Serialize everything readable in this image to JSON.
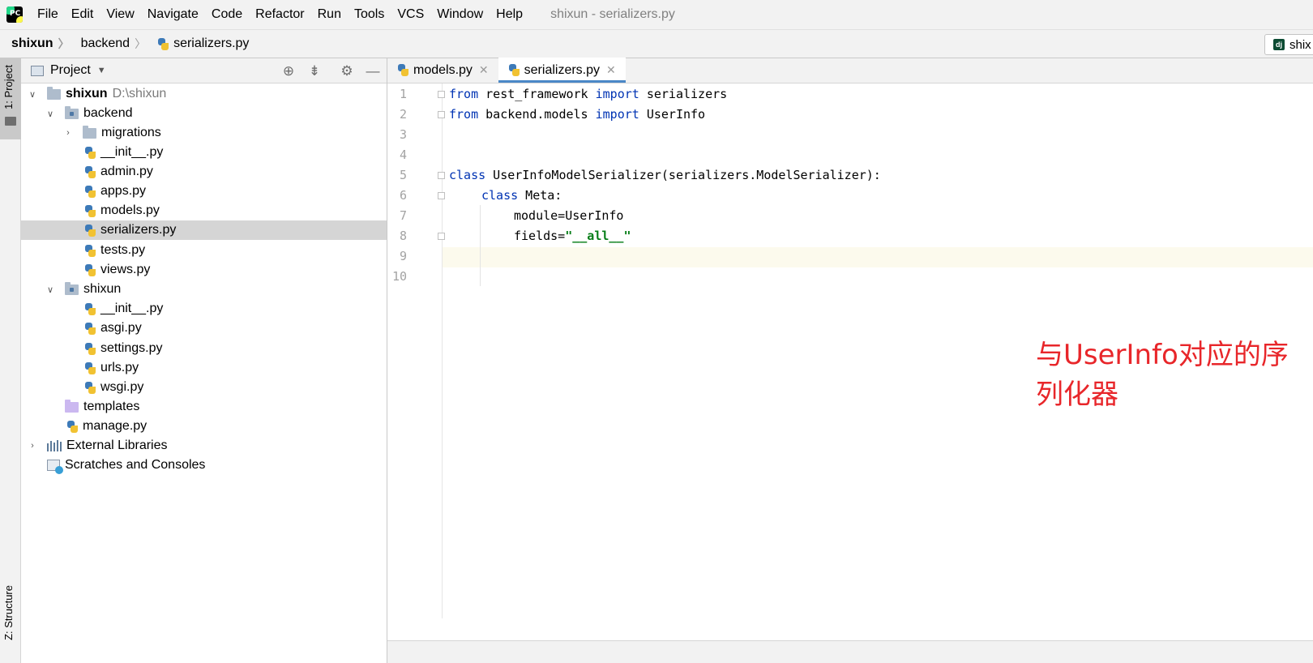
{
  "app": {
    "logo_text": "PC",
    "menu": [
      "File",
      "Edit",
      "View",
      "Navigate",
      "Code",
      "Refactor",
      "Run",
      "Tools",
      "VCS",
      "Window",
      "Help"
    ],
    "window_title": "shixun - serializers.py"
  },
  "breadcrumb": {
    "items": [
      "shixun",
      "backend",
      "serializers.py"
    ],
    "run_config_label": "shix",
    "run_config_icon": "dj"
  },
  "tool_strip": {
    "project_label": "1: Project",
    "structure_label": "Z: Structure"
  },
  "project_panel": {
    "title": "Project",
    "root_name": "shixun",
    "root_path": "D:\\shixun",
    "tree": [
      {
        "label": "backend",
        "type": "folder"
      },
      {
        "label": "migrations",
        "type": "folder"
      },
      {
        "label": "__init__.py",
        "type": "file"
      },
      {
        "label": "admin.py",
        "type": "file"
      },
      {
        "label": "apps.py",
        "type": "file"
      },
      {
        "label": "models.py",
        "type": "file"
      },
      {
        "label": "serializers.py",
        "type": "file",
        "selected": true
      },
      {
        "label": "tests.py",
        "type": "file"
      },
      {
        "label": "views.py",
        "type": "file"
      },
      {
        "label": "shixun",
        "type": "folder"
      },
      {
        "label": "__init__.py",
        "type": "file"
      },
      {
        "label": "asgi.py",
        "type": "file"
      },
      {
        "label": "settings.py",
        "type": "file"
      },
      {
        "label": "urls.py",
        "type": "file"
      },
      {
        "label": "wsgi.py",
        "type": "file"
      },
      {
        "label": "templates",
        "type": "folder"
      },
      {
        "label": "manage.py",
        "type": "file"
      },
      {
        "label": "External Libraries",
        "type": "library"
      },
      {
        "label": "Scratches and Consoles",
        "type": "scratch"
      }
    ]
  },
  "editor": {
    "tabs": [
      {
        "label": "models.py",
        "active": false
      },
      {
        "label": "serializers.py",
        "active": true
      }
    ],
    "line_numbers": [
      "1",
      "2",
      "3",
      "4",
      "5",
      "6",
      "7",
      "8",
      "9",
      "10"
    ],
    "code": {
      "l1_kw1": "from",
      "l1_mid": " rest_framework ",
      "l1_kw2": "import",
      "l1_end": " serializers",
      "l2_kw1": "from",
      "l2_mid": " backend.models ",
      "l2_kw2": "import",
      "l2_end": " UserInfo",
      "l5_kw": "class",
      "l5_rest": " UserInfoModelSerializer(serializers.ModelSerializer):",
      "l6_kw": "class",
      "l6_rest": " Meta:",
      "l7": "module=UserInfo",
      "l8_pre": "fields=",
      "l8_str": "\"__all__\""
    },
    "annotation": "与UserInfo对应的序列化器"
  },
  "colors": {
    "keyword": "#0033b3",
    "string": "#067d17",
    "annotation": "#e8262a",
    "tab_underline": "#4a88c7"
  }
}
